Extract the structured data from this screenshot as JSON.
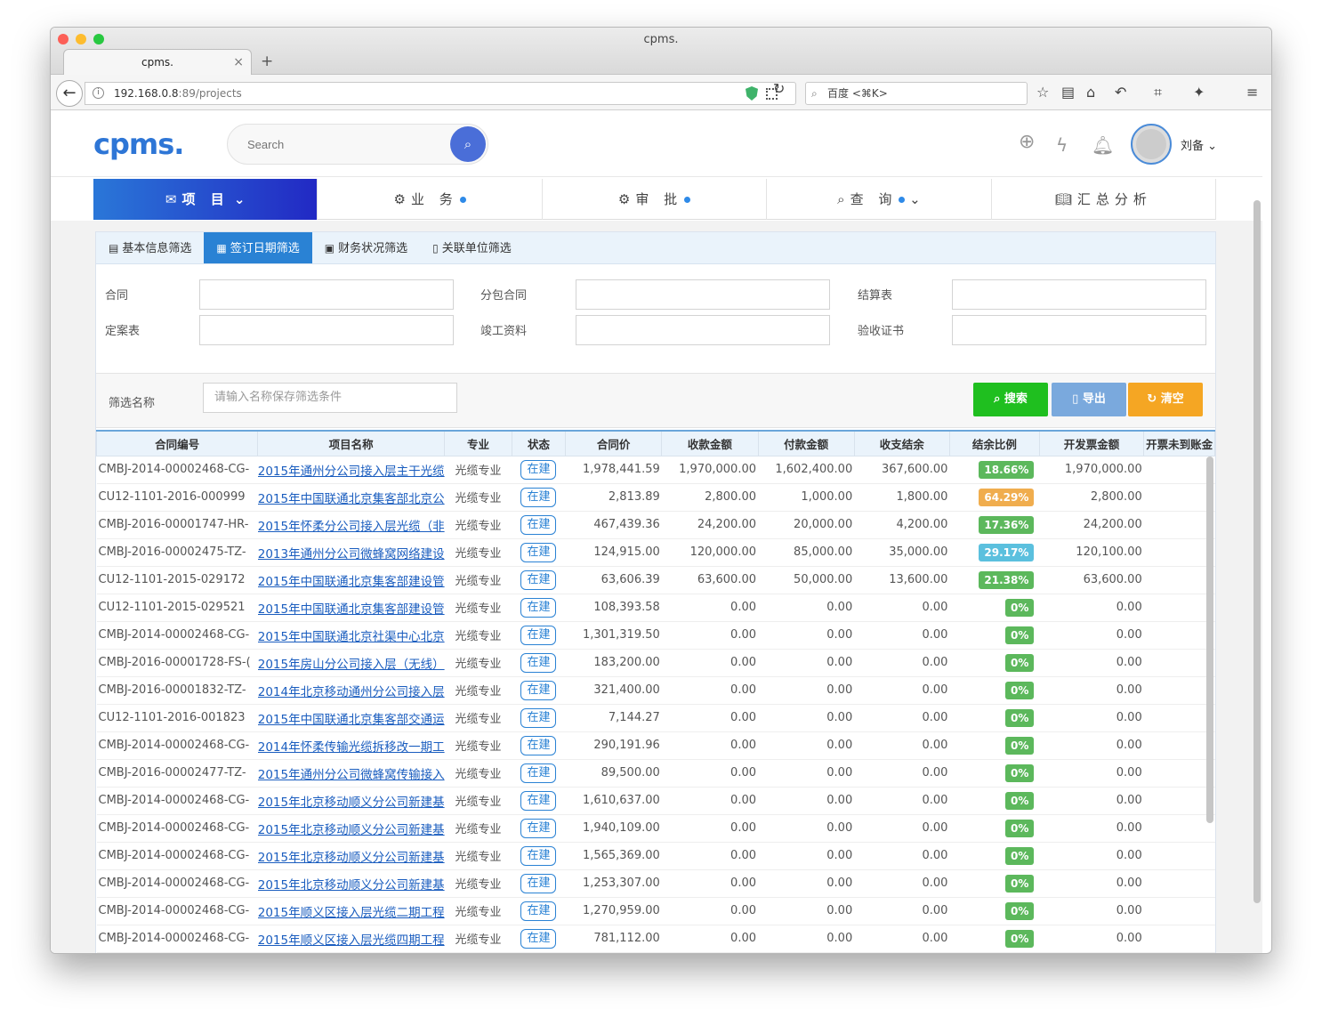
{
  "browser": {
    "title": "cpms.",
    "tab_label": "cpms.",
    "url_host": "192.168.0.8",
    "url_rest": ":89/projects",
    "search_placeholder": "百度 <⌘K>"
  },
  "app": {
    "logo": "cpms.",
    "search_placeholder": "Search",
    "username": "刘备"
  },
  "nav": [
    {
      "label": "项 目",
      "active": true,
      "dot": false,
      "caret": true,
      "icon": "inbox-icon"
    },
    {
      "label": "业 务",
      "active": false,
      "dot": true,
      "caret": false,
      "icon": "gear-icon"
    },
    {
      "label": "审 批",
      "active": false,
      "dot": true,
      "caret": false,
      "icon": "gear-icon"
    },
    {
      "label": "查 询",
      "active": false,
      "dot": true,
      "caret": true,
      "icon": "search-icon"
    },
    {
      "label": "汇总分析",
      "active": false,
      "dot": false,
      "caret": false,
      "icon": "book-icon"
    }
  ],
  "filter_tabs": [
    {
      "label": "基本信息筛选",
      "active": false
    },
    {
      "label": "签订日期筛选",
      "active": true
    },
    {
      "label": "财务状况筛选",
      "active": false
    },
    {
      "label": "关联单位筛选",
      "active": false
    }
  ],
  "filter_fields": [
    "合同",
    "分包合同",
    "结算表",
    "定案表",
    "竣工资料",
    "验收证书"
  ],
  "save": {
    "label": "筛选名称",
    "placeholder": "请输入名称保存筛选条件"
  },
  "buttons": {
    "search": "搜索",
    "export": "导出",
    "clear": "清空"
  },
  "colors": {
    "search": "#1fbf1f",
    "export": "#7aa9dd",
    "clear": "#f5a623",
    "green": "#5cb85c",
    "orange": "#f0ad4e",
    "blue": "#5bc0de",
    "active_tab": "#2a82d4"
  },
  "columns": [
    "合同编号",
    "项目名称",
    "专业",
    "状态",
    "合同价",
    "收款金额",
    "付款金额",
    "收支结余",
    "结余比例",
    "开发票金额",
    "开票未到账金"
  ],
  "rows": [
    [
      "CMBJ-2014-00002468-CG-",
      "2015年通州分公司接入层主干光缆",
      "光缆专业",
      "在建",
      "1,978,441.59",
      "1,970,000.00",
      "1,602,400.00",
      "367,600.00",
      "18.66%",
      "1,970,000.00",
      "green"
    ],
    [
      "CU12-1101-2016-000999",
      "2015年中国联通北京集客部北京公",
      "光缆专业",
      "在建",
      "2,813.89",
      "2,800.00",
      "1,000.00",
      "1,800.00",
      "64.29%",
      "2,800.00",
      "orange"
    ],
    [
      "CMBJ-2016-00001747-HR-",
      "2015年怀柔分公司接入层光缆（非",
      "光缆专业",
      "在建",
      "467,439.36",
      "24,200.00",
      "20,000.00",
      "4,200.00",
      "17.36%",
      "24,200.00",
      "green"
    ],
    [
      "CMBJ-2016-00002475-TZ-",
      "2013年通州分公司微蜂窝网络建设",
      "光缆专业",
      "在建",
      "124,915.00",
      "120,000.00",
      "85,000.00",
      "35,000.00",
      "29.17%",
      "120,100.00",
      "blue"
    ],
    [
      "CU12-1101-2015-029172",
      "2015年中国联通北京集客部建设管",
      "光缆专业",
      "在建",
      "63,606.39",
      "63,600.00",
      "50,000.00",
      "13,600.00",
      "21.38%",
      "63,600.00",
      "green"
    ],
    [
      "CU12-1101-2015-029521",
      "2015年中国联通北京集客部建设管",
      "光缆专业",
      "在建",
      "108,393.58",
      "0.00",
      "0.00",
      "0.00",
      "0%",
      "0.00",
      "green"
    ],
    [
      "CMBJ-2014-00002468-CG-",
      "2015年中国联通北京社渠中心北京",
      "光缆专业",
      "在建",
      "1,301,319.50",
      "0.00",
      "0.00",
      "0.00",
      "0%",
      "0.00",
      "green"
    ],
    [
      "CMBJ-2016-00001728-FS-(",
      "2015年房山分公司接入层（无线）",
      "光缆专业",
      "在建",
      "183,200.00",
      "0.00",
      "0.00",
      "0.00",
      "0%",
      "0.00",
      "green"
    ],
    [
      "CMBJ-2016-00001832-TZ-",
      "2014年北京移动通州分公司接入层",
      "光缆专业",
      "在建",
      "321,400.00",
      "0.00",
      "0.00",
      "0.00",
      "0%",
      "0.00",
      "green"
    ],
    [
      "CU12-1101-2016-001823",
      "2015年中国联通北京集客部交通运",
      "光缆专业",
      "在建",
      "7,144.27",
      "0.00",
      "0.00",
      "0.00",
      "0%",
      "0.00",
      "green"
    ],
    [
      "CMBJ-2014-00002468-CG-",
      "2014年怀柔传输光缆拆移改一期工",
      "光缆专业",
      "在建",
      "290,191.96",
      "0.00",
      "0.00",
      "0.00",
      "0%",
      "0.00",
      "green"
    ],
    [
      "CMBJ-2016-00002477-TZ-",
      "2015年通州分公司微蜂窝传输接入",
      "光缆专业",
      "在建",
      "89,500.00",
      "0.00",
      "0.00",
      "0.00",
      "0%",
      "0.00",
      "green"
    ],
    [
      "CMBJ-2014-00002468-CG-",
      "2015年北京移动顺义分公司新建基",
      "光缆专业",
      "在建",
      "1,610,637.00",
      "0.00",
      "0.00",
      "0.00",
      "0%",
      "0.00",
      "green"
    ],
    [
      "CMBJ-2014-00002468-CG-",
      "2015年北京移动顺义分公司新建基",
      "光缆专业",
      "在建",
      "1,940,109.00",
      "0.00",
      "0.00",
      "0.00",
      "0%",
      "0.00",
      "green"
    ],
    [
      "CMBJ-2014-00002468-CG-",
      "2015年北京移动顺义分公司新建基",
      "光缆专业",
      "在建",
      "1,565,369.00",
      "0.00",
      "0.00",
      "0.00",
      "0%",
      "0.00",
      "green"
    ],
    [
      "CMBJ-2014-00002468-CG-",
      "2015年北京移动顺义分公司新建基",
      "光缆专业",
      "在建",
      "1,253,307.00",
      "0.00",
      "0.00",
      "0.00",
      "0%",
      "0.00",
      "green"
    ],
    [
      "CMBJ-2014-00002468-CG-",
      "2015年顺义区接入层光缆二期工程",
      "光缆专业",
      "在建",
      "1,270,959.00",
      "0.00",
      "0.00",
      "0.00",
      "0%",
      "0.00",
      "green"
    ],
    [
      "CMBJ-2014-00002468-CG-",
      "2015年顺义区接入层光缆四期工程",
      "光缆专业",
      "在建",
      "781,112.00",
      "0.00",
      "0.00",
      "0.00",
      "0%",
      "0.00",
      "green"
    ]
  ]
}
